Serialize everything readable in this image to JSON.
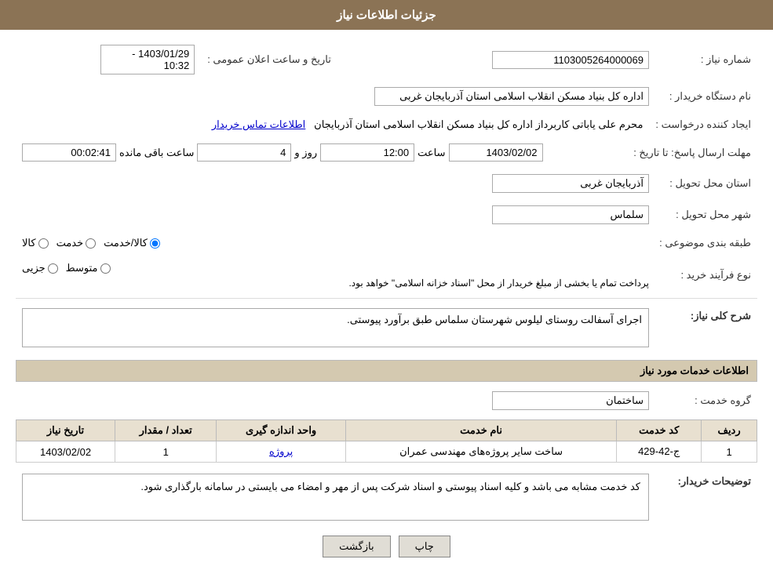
{
  "header": {
    "title": "جزئیات اطلاعات نیاز"
  },
  "fields": {
    "need_number_label": "شماره نیاز :",
    "need_number_value": "1103005264000069",
    "buyer_label": "نام دستگاه خریدار :",
    "buyer_value": "اداره کل بنیاد مسکن انقلاب اسلامی استان آذربایجان غربی",
    "creator_label": "ایجاد کننده درخواست :",
    "creator_value": "محرم علی یاباتی کاربرداز اداره کل بنیاد مسکن انقلاب اسلامی استان آذربایجان",
    "contact_link": "اطلاعات تماس خریدار",
    "deadline_label": "مهلت ارسال پاسخ: تا تاریخ :",
    "deadline_date": "1403/02/02",
    "deadline_time_label": "ساعت",
    "deadline_time": "12:00",
    "deadline_days_label": "روز و",
    "deadline_days": "4",
    "deadline_remaining_label": "ساعت باقی مانده",
    "deadline_remaining": "00:02:41",
    "province_label": "استان محل تحویل :",
    "province_value": "آذربایجان غربی",
    "city_label": "شهر محل تحویل :",
    "city_value": "سلماس",
    "category_label": "طبقه بندی موضوعی :",
    "category_options": [
      "کالا",
      "خدمت",
      "کالا/خدمت"
    ],
    "category_selected": "کالا/خدمت",
    "process_label": "نوع فرآیند خرید :",
    "process_options": [
      "جزیی",
      "متوسط"
    ],
    "process_note": "پرداخت تمام یا بخشی از مبلغ خریدار از محل \"اسناد خزانه اسلامی\" خواهد بود.",
    "date_time_label": "تاریخ و ساعت اعلان عمومی :",
    "date_time_value": "1403/01/29 - 10:32",
    "description_section_label": "شرح کلی نیاز:",
    "description_value": "اجرای آسفالت روستای لیلوس شهرستان سلماس طبق برآورد پیوستی.",
    "services_section_label": "اطلاعات خدمات مورد نیاز",
    "service_group_label": "گروه خدمت :",
    "service_group_value": "ساختمان",
    "table_headers": [
      "ردیف",
      "کد خدمت",
      "نام خدمت",
      "واحد اندازه گیری",
      "تعداد / مقدار",
      "تاریخ نیاز"
    ],
    "table_rows": [
      {
        "row": "1",
        "code": "ج-42-429",
        "name": "ساخت سایر پروژه‌های مهندسی عمران",
        "unit": "پروژه",
        "quantity": "1",
        "date": "1403/02/02"
      }
    ],
    "buyer_notes_label": "توضیحات خریدار:",
    "buyer_notes_value": "کد خدمت مشابه می باشد و کلیه اسناد پیوستی و اسناد شرکت پس از مهر و امضاء می بایستی در سامانه بارگذاری شود.",
    "btn_back": "بازگشت",
    "btn_print": "چاپ"
  }
}
